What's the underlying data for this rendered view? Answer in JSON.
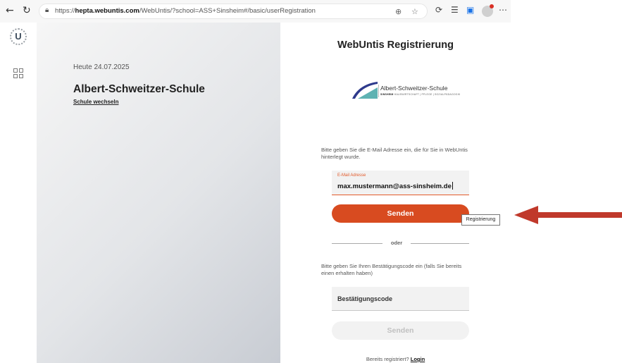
{
  "browser": {
    "back_icon": "arrow-left-icon",
    "reload_icon": "reload-icon",
    "url_prefix": "https://",
    "url_host": "hepta.webuntis.com",
    "url_path": "/WebUntis/?school=ASS+Sinsheim#/basic/userRegistration"
  },
  "sidebar": {
    "logo_letter": "U"
  },
  "left_panel": {
    "date": "Heute 24.07.2025",
    "school_name": "Albert-Schweitzer-Schule",
    "switch_school": "Schule wechseln"
  },
  "form": {
    "title": "WebUntis Registrierung",
    "logo_name": "Albert-Schweitzer-Schule",
    "logo_city": "SINSHEIM",
    "logo_tagline": "HAUSWIRTSCHAFT | PFLEGE | SOZIALPÄDAGOGIK",
    "instruction_email": "Bitte geben Sie die E-Mail Adresse ein, die für Sie in WebUntis hinterlegt wurde.",
    "email_label": "E-Mail Adresse",
    "email_value": "max.mustermann@ass-sinsheim.de",
    "send_label": "Senden",
    "tooltip": "Registrierung",
    "or_label": "oder",
    "instruction_code": "Bitte geben Sie Ihren Bestätigungscode ein (falls Sie bereits einen erhalten haben)",
    "code_placeholder": "Bestätigungscode",
    "send_label_2": "Senden",
    "footer_text": "Bereits registriert?",
    "footer_link": "Login"
  },
  "colors": {
    "accent": "#d84b20",
    "annotation_arrow": "#c0392b"
  }
}
